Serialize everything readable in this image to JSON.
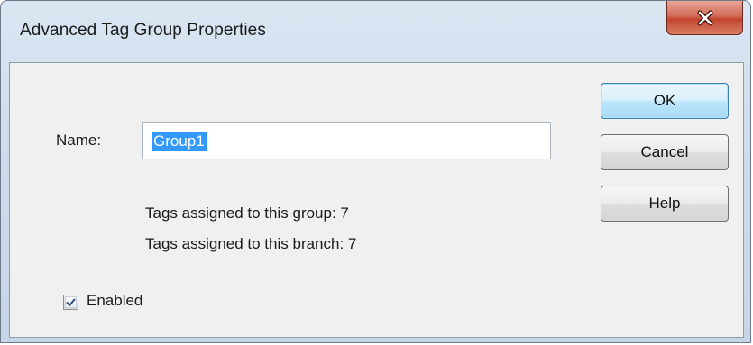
{
  "window": {
    "title": "Advanced Tag Group Properties",
    "close_icon": "close-icon"
  },
  "form": {
    "name_label": "Name:",
    "name_value": "Group1",
    "tags_group_text": "Tags assigned to this group: 7",
    "tags_branch_text": "Tags assigned to this branch: 7",
    "enabled_label": "Enabled",
    "enabled_checked": true
  },
  "buttons": {
    "ok": "OK",
    "cancel": "Cancel",
    "help": "Help"
  },
  "colors": {
    "selection": "#3399ff",
    "close_button": "#c3452f",
    "default_button_border": "#3c7fb1"
  }
}
